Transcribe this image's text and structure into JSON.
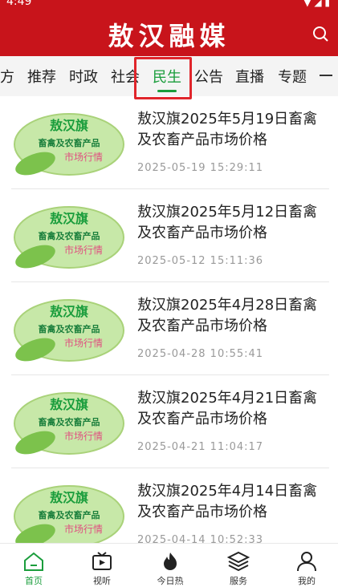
{
  "status": {
    "time": "4:49"
  },
  "header": {
    "title": "敖汉融媒"
  },
  "tabs": [
    {
      "label": "方"
    },
    {
      "label": "推荐"
    },
    {
      "label": "时政"
    },
    {
      "label": "社会"
    },
    {
      "label": "民生",
      "active": true
    },
    {
      "label": "公告"
    },
    {
      "label": "直播"
    },
    {
      "label": "专题"
    }
  ],
  "thumbnail": {
    "line1": "敖汉旗",
    "line2": "畜禽及农畜产品",
    "line3": "市场行情"
  },
  "news": [
    {
      "title": "敖汉旗2025年5月19日畜禽及农畜产品市场价格",
      "date": "2025-05-19  15:29:11"
    },
    {
      "title": "敖汉旗2025年5月12日畜禽及农畜产品市场价格",
      "date": "2025-05-12  15:11:36"
    },
    {
      "title": "敖汉旗2025年4月28日畜禽及农畜产品市场价格",
      "date": "2025-04-28  10:55:41"
    },
    {
      "title": "敖汉旗2025年4月21日畜禽及农畜产品市场价格",
      "date": "2025-04-21  11:04:17"
    },
    {
      "title": "敖汉旗2025年4月14日畜禽及农畜产品市场价格",
      "date": "2025-04-14  10:52:33"
    }
  ],
  "bottom_nav": [
    {
      "label": "首页",
      "icon": "home-icon",
      "active": true
    },
    {
      "label": "视听",
      "icon": "tv-icon"
    },
    {
      "label": "今日热",
      "icon": "fire-icon"
    },
    {
      "label": "服务",
      "icon": "layers-icon"
    },
    {
      "label": "我的",
      "icon": "user-icon"
    }
  ],
  "colors": {
    "brand_red": "#c8141b",
    "active_green": "#1a9d3c"
  }
}
